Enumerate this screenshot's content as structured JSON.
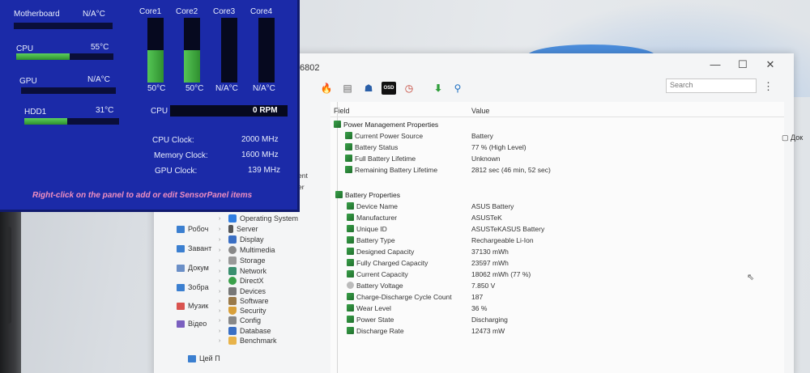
{
  "window": {
    "title": "6802",
    "search_placeholder": "Search"
  },
  "toolbar": {
    "icons": [
      "flame-icon",
      "printer-icon",
      "user-icon",
      "osd-icon",
      "clock-icon",
      "download-icon",
      "search-icon"
    ],
    "osd_label": "OSD"
  },
  "explorer": {
    "items": [
      {
        "label": "Робоч",
        "icon": "desktop-icon",
        "color": "#3b7fd0"
      },
      {
        "label": "Завант",
        "icon": "download-icon",
        "color": "#3b7fd0"
      },
      {
        "label": "Докум",
        "icon": "document-icon",
        "color": "#6b8fc7"
      },
      {
        "label": "Зобра",
        "icon": "pictures-icon",
        "color": "#3b7fd0"
      },
      {
        "label": "Музик",
        "icon": "music-icon",
        "color": "#d9534f"
      },
      {
        "label": "Відео",
        "icon": "video-icon",
        "color": "#7a5fbf"
      },
      {
        "label": "Цей П",
        "icon": "computer-icon",
        "color": "#3b7fd0"
      }
    ],
    "side_doc": "Док",
    "partial_1": "ent",
    "partial_2": "er"
  },
  "tree": {
    "items": [
      {
        "label": "Operating System",
        "color": "#2f7de1"
      },
      {
        "label": "Server",
        "color": "#555"
      },
      {
        "label": "Display",
        "color": "#3a6fc4"
      },
      {
        "label": "Multimedia",
        "color": "#888"
      },
      {
        "label": "Storage",
        "color": "#999"
      },
      {
        "label": "Network",
        "color": "#3a8f6f"
      },
      {
        "label": "DirectX",
        "color": "#3aa04a"
      },
      {
        "label": "Devices",
        "color": "#777"
      },
      {
        "label": "Software",
        "color": "#9a7a4a"
      },
      {
        "label": "Security",
        "color": "#d9a03a"
      },
      {
        "label": "Config",
        "color": "#888"
      },
      {
        "label": "Database",
        "color": "#3a6fc4"
      },
      {
        "label": "Benchmark",
        "color": "#e8b34a"
      }
    ]
  },
  "table": {
    "field_header": "Field",
    "value_header": "Value",
    "groups": [
      {
        "title": "Power Management Properties",
        "rows": [
          {
            "field": "Current Power Source",
            "value": "Battery"
          },
          {
            "field": "Battery Status",
            "value": "77 % (High Level)"
          },
          {
            "field": "Full Battery Lifetime",
            "value": "Unknown"
          },
          {
            "field": "Remaining Battery Lifetime",
            "value": "2812 sec (46 min, 52 sec)"
          }
        ]
      },
      {
        "title": "Battery Properties",
        "rows": [
          {
            "field": "Device Name",
            "value": "ASUS Battery"
          },
          {
            "field": "Manufacturer",
            "value": "ASUSTeK"
          },
          {
            "field": "Unique ID",
            "value": "ASUSTeKASUS Battery"
          },
          {
            "field": "Battery Type",
            "value": "Rechargeable Li-Ion"
          },
          {
            "field": "Designed Capacity",
            "value": "37130 mWh"
          },
          {
            "field": "Fully Charged Capacity",
            "value": "23597 mWh"
          },
          {
            "field": "Current Capacity",
            "value": "18062 mWh  (77 %)"
          },
          {
            "field": "Battery Voltage",
            "value": "7.850 V"
          },
          {
            "field": "Charge-Discharge Cycle Count",
            "value": "187"
          },
          {
            "field": "Wear Level",
            "value": "36 %"
          },
          {
            "field": "Power State",
            "value": "Discharging"
          },
          {
            "field": "Discharge Rate",
            "value": "12473 mW"
          }
        ]
      }
    ]
  },
  "sensor_panel": {
    "rows": [
      {
        "label": "Motherboard",
        "value": "N/A°C",
        "level": 0
      },
      {
        "label": "CPU",
        "value": "55°C",
        "level": 0.55
      },
      {
        "label": "GPU",
        "value": "N/A°C",
        "level": 0
      },
      {
        "label": "HDD1",
        "value": "31°C",
        "level": 0.45
      }
    ],
    "cores": [
      {
        "label": "Core1",
        "value": "50°C",
        "level": 0.5
      },
      {
        "label": "Core2",
        "value": "50°C",
        "level": 0.5
      },
      {
        "label": "Core3",
        "value": "N/A°C",
        "level": 0
      },
      {
        "label": "Core4",
        "value": "N/A°C",
        "level": 0
      }
    ],
    "fan_label": "CPU",
    "fan_value": "0 RPM",
    "clocks": [
      {
        "label": "CPU Clock:",
        "value": "2000 MHz"
      },
      {
        "label": "Memory Clock:",
        "value": "1600 MHz"
      },
      {
        "label": "GPU Clock:",
        "value": "139 MHz"
      }
    ],
    "hint": "Right-click on the panel to add or edit SensorPanel items",
    "bar_color": "#3fb23f",
    "background_color": "#1b2aa8"
  }
}
